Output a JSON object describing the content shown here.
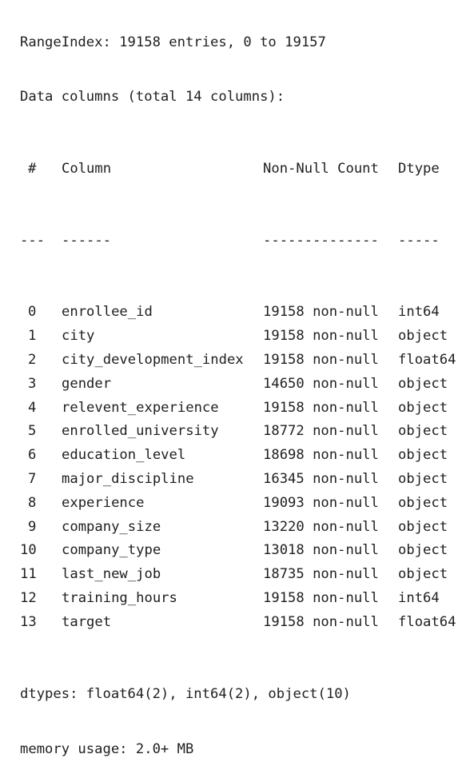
{
  "summary": {
    "range_index": "RangeIndex: 19158 entries, 0 to 19157",
    "data_columns": "Data columns (total 14 columns):"
  },
  "table": {
    "headers": {
      "num": "#",
      "column": "Column",
      "count": "Non-Null Count",
      "dtype": "Dtype"
    },
    "separators": {
      "num": "---",
      "column": "------",
      "count": "--------------",
      "dtype": "-----"
    },
    "rows": [
      {
        "num": "0",
        "column": "enrollee_id",
        "count": "19158 non-null",
        "dtype": "int64"
      },
      {
        "num": "1",
        "column": "city",
        "count": "19158 non-null",
        "dtype": "object"
      },
      {
        "num": "2",
        "column": "city_development_index",
        "count": "19158 non-null",
        "dtype": "float64"
      },
      {
        "num": "3",
        "column": "gender",
        "count": "14650 non-null",
        "dtype": "object"
      },
      {
        "num": "4",
        "column": "relevent_experience",
        "count": "19158 non-null",
        "dtype": "object"
      },
      {
        "num": "5",
        "column": "enrolled_university",
        "count": "18772 non-null",
        "dtype": "object"
      },
      {
        "num": "6",
        "column": "education_level",
        "count": "18698 non-null",
        "dtype": "object"
      },
      {
        "num": "7",
        "column": "major_discipline",
        "count": "16345 non-null",
        "dtype": "object"
      },
      {
        "num": "8",
        "column": "experience",
        "count": "19093 non-null",
        "dtype": "object"
      },
      {
        "num": "9",
        "column": "company_size",
        "count": "13220 non-null",
        "dtype": "object"
      },
      {
        "num": "10",
        "column": "company_type",
        "count": "13018 non-null",
        "dtype": "object"
      },
      {
        "num": "11",
        "column": "last_new_job",
        "count": "18735 non-null",
        "dtype": "object"
      },
      {
        "num": "12",
        "column": "training_hours",
        "count": "19158 non-null",
        "dtype": "int64"
      },
      {
        "num": "13",
        "column": "target",
        "count": "19158 non-null",
        "dtype": "float64"
      }
    ]
  },
  "footer": {
    "dtypes": "dtypes: float64(2), int64(2), object(10)",
    "memory": "memory usage: 2.0+ MB"
  }
}
